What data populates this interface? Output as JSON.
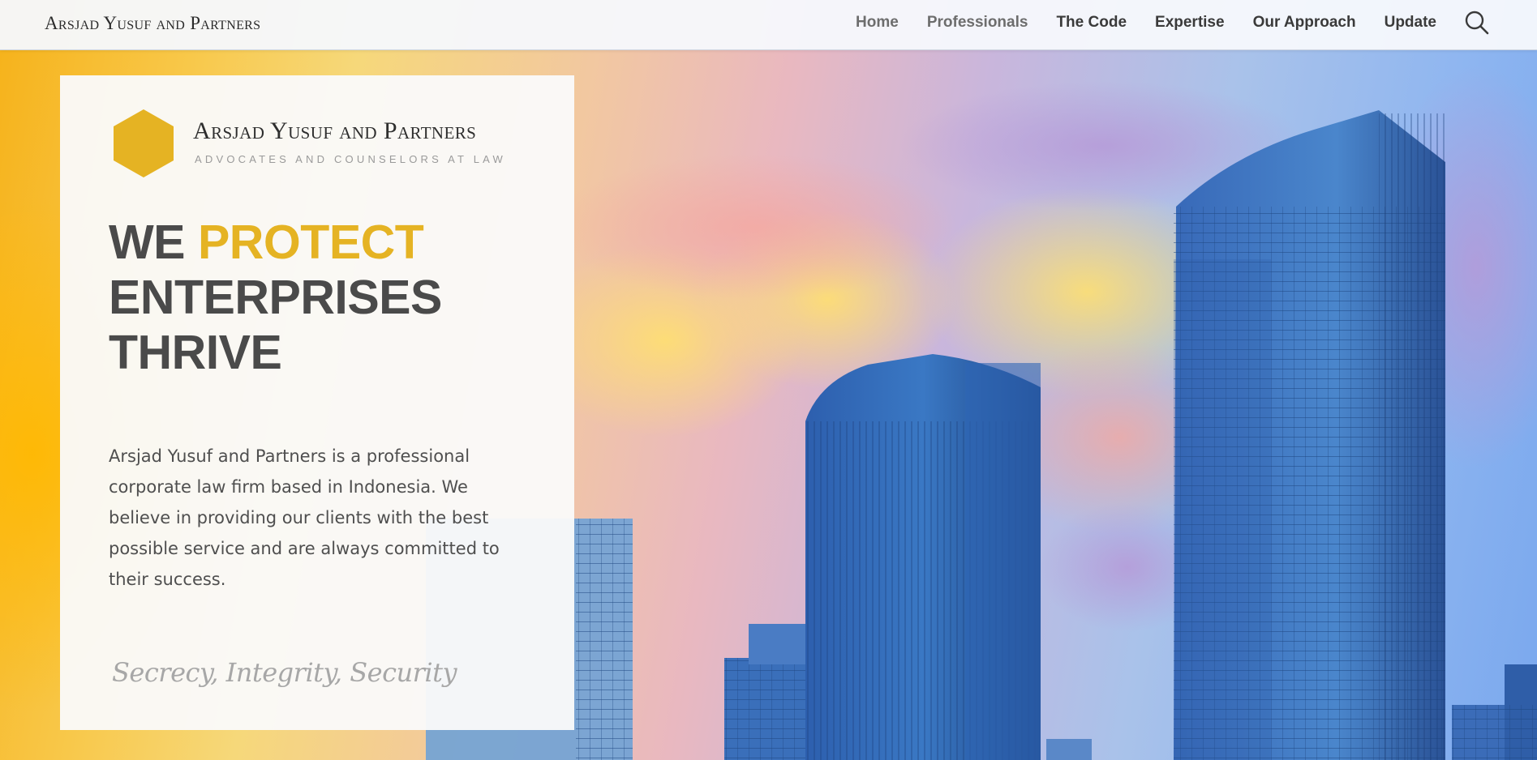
{
  "header": {
    "brand": "Arsjad Yusuf and Partners",
    "nav": [
      {
        "label": "Home"
      },
      {
        "label": "Professionals"
      },
      {
        "label": "The Code"
      },
      {
        "label": "Expertise"
      },
      {
        "label": "Our Approach"
      },
      {
        "label": "Update"
      }
    ],
    "search_icon": "search-icon"
  },
  "hero_card": {
    "logo_icon": "hexagon-icon",
    "firm_name": "Arsjad Yusuf and Partners",
    "tagline": "ADVOCATES AND COUNSELORS AT LAW",
    "headline": {
      "line1_a": "WE ",
      "line1_b": "PROTECT",
      "line2": "ENTERPRISES",
      "line3": "THRIVE"
    },
    "description": "Arsjad Yusuf and Partners is a professional corporate law firm based in Indonesia. We believe in providing our clients with the best possible service and are always committed to their success.",
    "motto": "Secrecy, Integrity, Security"
  },
  "colors": {
    "accent": "#e5b323",
    "heading": "#4a4a4a",
    "text": "#4f4f4f"
  }
}
